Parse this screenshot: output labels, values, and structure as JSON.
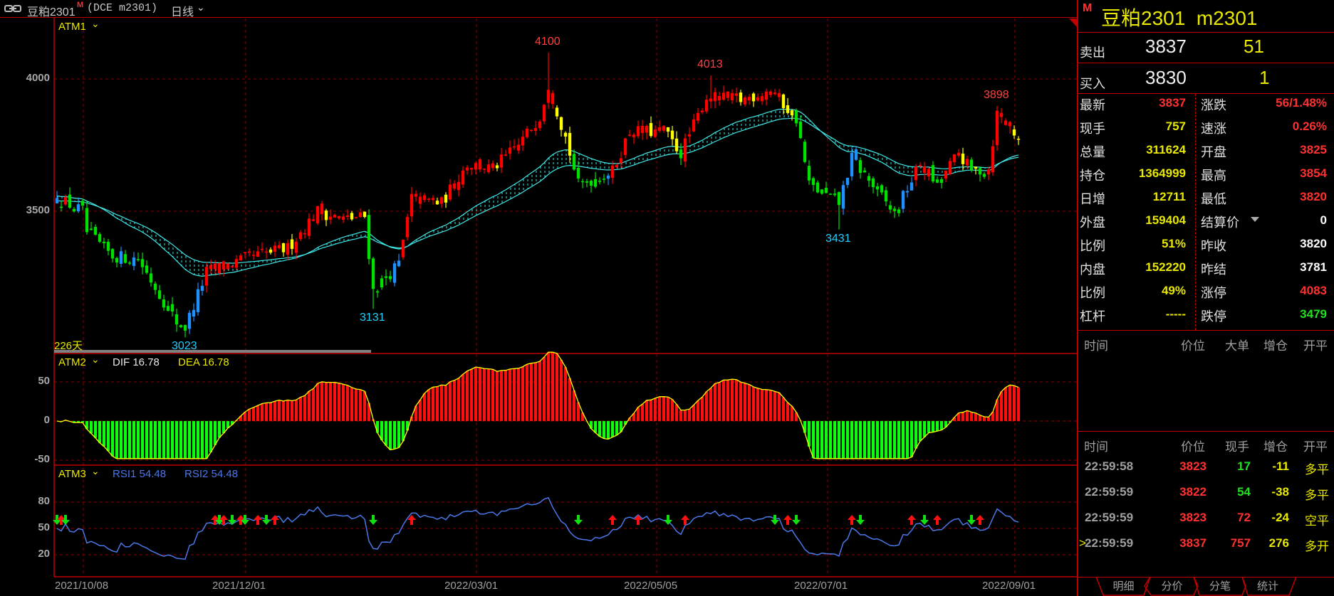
{
  "titlebar": {
    "name": "豆粕2301",
    "market_flag": "M",
    "code": "(DCE m2301)",
    "period": "日线"
  },
  "main": {
    "indicator": "ATM1",
    "price_ticks": [
      {
        "value": 4000,
        "label": "4000"
      },
      {
        "value": 3500,
        "label": "3500"
      }
    ],
    "days_label": "226天",
    "bar_count": 226,
    "price_path": [
      [
        0,
        3550
      ],
      [
        6,
        3500
      ],
      [
        7,
        3420
      ],
      [
        13,
        3330
      ],
      [
        19,
        3320
      ],
      [
        28,
        3080
      ],
      [
        30,
        3060
      ],
      [
        35,
        3270
      ],
      [
        46,
        3330
      ],
      [
        54,
        3360
      ],
      [
        61,
        3500
      ],
      [
        67,
        3470
      ],
      [
        72,
        3480
      ],
      [
        74,
        3200
      ],
      [
        80,
        3300
      ],
      [
        83,
        3550
      ],
      [
        90,
        3530
      ],
      [
        96,
        3680
      ],
      [
        102,
        3660
      ],
      [
        108,
        3750
      ],
      [
        113,
        3860
      ],
      [
        115,
        3980
      ],
      [
        119,
        3780
      ],
      [
        122,
        3600
      ],
      [
        130,
        3650
      ],
      [
        134,
        3800
      ],
      [
        142,
        3800
      ],
      [
        146,
        3720
      ],
      [
        152,
        3930
      ],
      [
        160,
        3920
      ],
      [
        167,
        3960
      ],
      [
        173,
        3850
      ],
      [
        176,
        3600
      ],
      [
        183,
        3530
      ],
      [
        186,
        3700
      ],
      [
        196,
        3490
      ],
      [
        202,
        3680
      ],
      [
        206,
        3600
      ],
      [
        211,
        3720
      ],
      [
        214,
        3650
      ],
      [
        218,
        3660
      ],
      [
        220,
        3870
      ],
      [
        225,
        3780
      ]
    ],
    "extremes": [
      {
        "index": 115,
        "type": "high",
        "value": 4100,
        "label": "4100",
        "color": "#ff4040"
      },
      {
        "index": 153,
        "type": "high",
        "value": 4013,
        "label": "4013",
        "color": "#ff4040"
      },
      {
        "index": 220,
        "type": "high",
        "value": 3898,
        "label": "3898",
        "color": "#ff4040"
      },
      {
        "index": 30,
        "type": "low",
        "value": 3023,
        "label": "3023",
        "color": "#20d0ff"
      },
      {
        "index": 74,
        "type": "low",
        "value": 3131,
        "label": "3131",
        "color": "#20d0ff"
      },
      {
        "index": 183,
        "type": "low",
        "value": 3431,
        "label": "3431",
        "color": "#20d0ff"
      }
    ],
    "dates": [
      {
        "index": 0,
        "label": "2021/10/08"
      },
      {
        "index": 38,
        "label": "2021/12/01"
      },
      {
        "index": 92,
        "label": "2022/03/01"
      },
      {
        "index": 134,
        "label": "2022/05/05"
      },
      {
        "index": 174,
        "label": "2022/07/01"
      },
      {
        "index": 217,
        "label": "2022/09/01"
      }
    ]
  },
  "macd": {
    "indicator": "ATM2",
    "dif_label": "DIF 16.78",
    "dea_label": "DEA 16.78",
    "ticks": [
      {
        "value": 50,
        "label": "50"
      },
      {
        "value": 0,
        "label": "0"
      },
      {
        "value": -50,
        "label": "-50"
      }
    ]
  },
  "rsi": {
    "indicator": "ATM3",
    "rsi1_label": "RSI1 54.48",
    "rsi2_label": "RSI2 54.48",
    "ticks": [
      {
        "value": 80,
        "label": "80"
      },
      {
        "value": 50,
        "label": "50"
      },
      {
        "value": 20,
        "label": "20"
      }
    ],
    "signals": [
      {
        "i": 0,
        "t": "down"
      },
      {
        "i": 1,
        "t": "up"
      },
      {
        "i": 2,
        "t": "down"
      },
      {
        "i": 37,
        "t": "up"
      },
      {
        "i": 38,
        "t": "down"
      },
      {
        "i": 39,
        "t": "up"
      },
      {
        "i": 41,
        "t": "down"
      },
      {
        "i": 43,
        "t": "up"
      },
      {
        "i": 44,
        "t": "down"
      },
      {
        "i": 47,
        "t": "up"
      },
      {
        "i": 49,
        "t": "down"
      },
      {
        "i": 51,
        "t": "up"
      },
      {
        "i": 74,
        "t": "down"
      },
      {
        "i": 83,
        "t": "up"
      },
      {
        "i": 122,
        "t": "down"
      },
      {
        "i": 130,
        "t": "up"
      },
      {
        "i": 136,
        "t": "up"
      },
      {
        "i": 143,
        "t": "down"
      },
      {
        "i": 147,
        "t": "up"
      },
      {
        "i": 168,
        "t": "down"
      },
      {
        "i": 171,
        "t": "up"
      },
      {
        "i": 173,
        "t": "down"
      },
      {
        "i": 186,
        "t": "up"
      },
      {
        "i": 188,
        "t": "down"
      },
      {
        "i": 200,
        "t": "up"
      },
      {
        "i": 203,
        "t": "down"
      },
      {
        "i": 206,
        "t": "up"
      },
      {
        "i": 214,
        "t": "down"
      },
      {
        "i": 216,
        "t": "up"
      }
    ]
  },
  "quote": {
    "flag": "M",
    "title": "豆粕2301  m2301",
    "ask": {
      "label": "卖出",
      "price": "3837",
      "volume": "51"
    },
    "bid": {
      "label": "买入",
      "price": "3830",
      "volume": "1"
    },
    "left": [
      {
        "label": "最新",
        "value": "3837",
        "color": "#ff3030"
      },
      {
        "label": "现手",
        "value": "757",
        "color": "#e8e800"
      },
      {
        "label": "总量",
        "value": "311624",
        "color": "#e8e800"
      },
      {
        "label": "持仓",
        "value": "1364999",
        "color": "#e8e800"
      },
      {
        "label": "日增",
        "value": "12711",
        "color": "#e8e800"
      },
      {
        "label": "外盘",
        "value": "159404",
        "color": "#e8e800"
      },
      {
        "label": "比例",
        "value": "51%",
        "color": "#e8e800"
      },
      {
        "label": "内盘",
        "value": "152220",
        "color": "#e8e800"
      },
      {
        "label": "比例",
        "value": "49%",
        "color": "#e8e800"
      },
      {
        "label": "杠杆",
        "value": "-----",
        "color": "#e8e800"
      }
    ],
    "right": [
      {
        "label": "涨跌",
        "value": "56/1.48%",
        "color": "#ff3030"
      },
      {
        "label": "速涨",
        "value": "0.26%",
        "color": "#ff3030"
      },
      {
        "label": "开盘",
        "value": "3825",
        "color": "#ff3030"
      },
      {
        "label": "最高",
        "value": "3854",
        "color": "#ff3030"
      },
      {
        "label": "最低",
        "value": "3820",
        "color": "#ff3030"
      },
      {
        "label": "结算价",
        "value": "0",
        "color": "#ffffff"
      },
      {
        "label": "昨收",
        "value": "3820",
        "color": "#ffffff"
      },
      {
        "label": "昨结",
        "value": "3781",
        "color": "#ffffff"
      },
      {
        "label": "涨停",
        "value": "4083",
        "color": "#ff3030"
      },
      {
        "label": "跌停",
        "value": "3479",
        "color": "#20e020"
      }
    ]
  },
  "bigorders": {
    "headers": [
      "时间",
      "价位",
      "大单",
      "增仓",
      "开平"
    ]
  },
  "ticks": {
    "headers": [
      "时间",
      "价位",
      "现手",
      "增仓",
      "开平"
    ],
    "rows": [
      {
        "time": "22:59:58",
        "price": "3823",
        "vol": "17",
        "vol_color": "#20e020",
        "oi": "-11",
        "type": "多平",
        "current": false
      },
      {
        "time": "22:59:59",
        "price": "3822",
        "vol": "54",
        "vol_color": "#20e020",
        "oi": "-38",
        "type": "多平",
        "current": false
      },
      {
        "time": "22:59:59",
        "price": "3823",
        "vol": "72",
        "vol_color": "#ff3030",
        "oi": "-24",
        "type": "空平",
        "current": false
      },
      {
        "time": "22:59:59",
        "price": "3837",
        "vol": "757",
        "vol_color": "#ff3030",
        "oi": "276",
        "type": "多开",
        "current": true
      }
    ]
  },
  "tabs": [
    "明细",
    "分价",
    "分笔",
    "统计"
  ],
  "colors": {
    "grid": "#8b0000",
    "border": "#c00000",
    "band": "#40e8e8",
    "up": "#ff0000",
    "weak": "#ffff00",
    "down": "#00e000",
    "rebound": "#1e90ff",
    "rsi": "#4a78e8"
  }
}
